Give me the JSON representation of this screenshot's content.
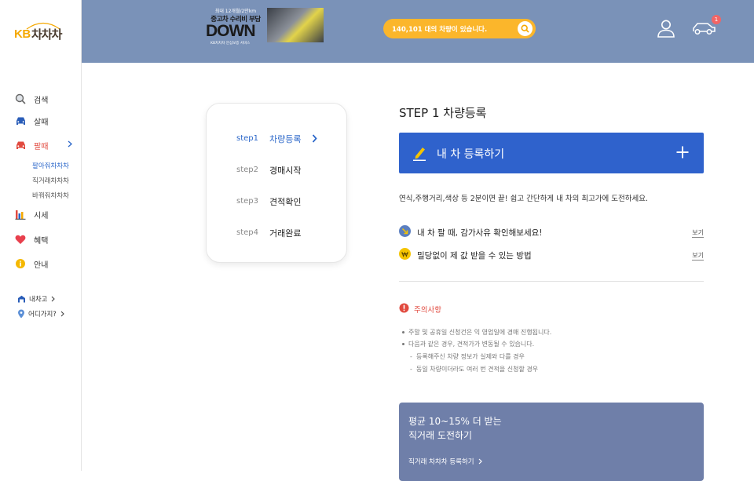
{
  "logo": {
    "kb": "KB",
    "name": "차차차"
  },
  "sidebar": {
    "items": [
      {
        "label": "검색",
        "icon": "search-icon"
      },
      {
        "label": "살때",
        "icon": "car-icon"
      },
      {
        "label": "팔때",
        "icon": "car-icon"
      },
      {
        "label": "시세",
        "icon": "bar-chart-icon"
      },
      {
        "label": "혜택",
        "icon": "heart-icon"
      },
      {
        "label": "안내",
        "icon": "info-icon"
      }
    ],
    "sub_items": [
      "팔아줘차차차",
      "직거래차차차",
      "바꿔줘차차차"
    ],
    "bottom": [
      {
        "label": "내차고",
        "icon": "garage-icon"
      },
      {
        "label": "어디가지?",
        "icon": "location-pin-icon"
      }
    ]
  },
  "header": {
    "banner": {
      "top": "최대 12개월/2만km",
      "sub": "중고차 수리비 부담",
      "big": "DOWN",
      "small": "KB차차차 안심보증 서비스"
    },
    "search_text": "140,101 대의 차량이 있습니다.",
    "cart_badge": "1"
  },
  "steps": [
    {
      "num": "step1",
      "label": "차량등록"
    },
    {
      "num": "step2",
      "label": "경매시작"
    },
    {
      "num": "step3",
      "label": "견적확인"
    },
    {
      "num": "step4",
      "label": "거래완료"
    }
  ],
  "main": {
    "title": "STEP 1 차량등록",
    "register_label": "내 차 등록하기",
    "desc": "연식,주행거리,색상 등 2분이면 끝! 쉽고 간단하게 내 차의 최고가에 도전하세요.",
    "tips": [
      {
        "label": "내 차 팔 때, 감가사유 확인해보세요!",
        "view": "보기"
      },
      {
        "label": "밀당없이 제 값 받을 수 있는 방법",
        "view": "보기"
      }
    ],
    "notice_title": "주의사항",
    "notice_lines": [
      "주말 및 공휴일 신청건은 익 영업일에 경매 진행됩니다.",
      "다음과 같은 경우, 견적가가 변동될 수 있습니다.",
      "등록해주신 차량 정보가 실제와 다를 경우",
      "동일 차량이더라도 여러 번 견적을 신청할 경우"
    ],
    "promo": {
      "line1": "평균 10~15% 더 받는",
      "line2": "직거래 도전하기",
      "link": "직거래 차차차 등록하기"
    }
  },
  "colors": {
    "header_bg": "#7a92b8",
    "search_bg": "#fbb62b",
    "primary_blue": "#2f62cc",
    "accent_red": "#e14a3f",
    "promo_bg": "#6f7fa9"
  }
}
